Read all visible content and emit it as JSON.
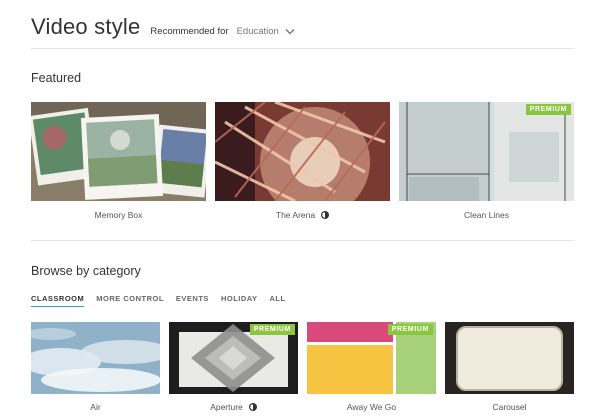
{
  "header": {
    "title": "Video style",
    "recommended_label": "Recommended for",
    "recommended_value": "Education"
  },
  "featured": {
    "title": "Featured",
    "items": [
      {
        "name": "Memory Box",
        "premium": false,
        "audio_icon": false
      },
      {
        "name": "The Arena",
        "premium": false,
        "audio_icon": true
      },
      {
        "name": "Clean Lines",
        "premium": true,
        "audio_icon": false
      }
    ]
  },
  "browse": {
    "title": "Browse by category",
    "tabs": [
      "CLASSROOM",
      "MORE CONTROL",
      "EVENTS",
      "HOLIDAY",
      "ALL"
    ],
    "active_tab": "CLASSROOM",
    "items": [
      {
        "name": "Air",
        "premium": false,
        "audio_icon": false
      },
      {
        "name": "Aperture",
        "premium": true,
        "audio_icon": true
      },
      {
        "name": "Away We Go",
        "premium": true,
        "audio_icon": false
      },
      {
        "name": "Carousel",
        "premium": false,
        "audio_icon": false
      }
    ]
  },
  "badge_label": "PREMIUM",
  "colors": {
    "premium_badge": "#8cc63f",
    "active_tab_underline": "#27a9c4",
    "divider": "#e4e4e4"
  },
  "icons": {
    "dropdown": "chevron-down-icon",
    "audio": "half-circle-icon"
  }
}
